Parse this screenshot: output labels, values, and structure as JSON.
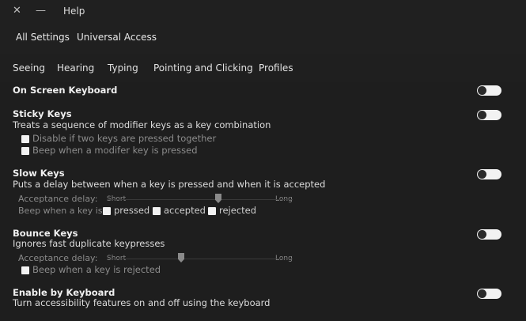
{
  "window": {
    "title": "Help"
  },
  "toolbar": {
    "all_settings": "All Settings",
    "universal_access": "Universal Access"
  },
  "tabs": [
    {
      "label": "Seeing"
    },
    {
      "label": "Hearing"
    },
    {
      "label": "Typing"
    },
    {
      "label": "Pointing and Clicking"
    },
    {
      "label": "Profiles"
    }
  ],
  "on_screen_keyboard": {
    "title": "On Screen Keyboard",
    "enabled": false
  },
  "sticky_keys": {
    "title": "Sticky Keys",
    "description": "Treats a sequence of modifier keys as a key combination",
    "enabled": false,
    "options": [
      {
        "label": "Disable if two keys are pressed together",
        "checked": false
      },
      {
        "label": "Beep when a modifer key is pressed",
        "checked": false
      }
    ]
  },
  "slow_keys": {
    "title": "Slow Keys",
    "description": "Puts a delay between when a key is pressed and when it is accepted",
    "enabled": false,
    "acceptance_delay_label": "Acceptance delay:",
    "short_label": "Short",
    "long_label": "Long",
    "delay_value": 0.6,
    "beep_label": "Beep when a key is",
    "beep_options": [
      {
        "label": "pressed",
        "checked": false
      },
      {
        "label": "accepted",
        "checked": false
      },
      {
        "label": "rejected",
        "checked": false
      }
    ]
  },
  "bounce_keys": {
    "title": "Bounce Keys",
    "description": "Ignores fast duplicate keypresses",
    "enabled": false,
    "acceptance_delay_label": "Acceptance delay:",
    "short_label": "Short",
    "long_label": "Long",
    "delay_value": 0.4,
    "beep_rejected": {
      "label": "Beep when a key is rejected",
      "checked": false
    }
  },
  "enable_by_keyboard": {
    "title": "Enable by Keyboard",
    "description": "Turn accessibility features on and off using the keyboard",
    "enabled": false
  }
}
